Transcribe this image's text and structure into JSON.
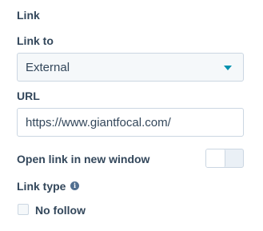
{
  "section": {
    "title": "Link"
  },
  "link_to": {
    "label": "Link to",
    "selected_value": "External",
    "caret_icon": "caret-down-icon",
    "caret_color": "#0091ae"
  },
  "url": {
    "label": "URL",
    "value": "https://www.giantfocal.com/"
  },
  "new_window": {
    "label": "Open link in new window",
    "enabled": false
  },
  "link_type": {
    "label": "Link type",
    "info_icon": "info-icon",
    "info_glyph": "i",
    "options": [
      {
        "label": "No follow",
        "checked": false
      }
    ]
  },
  "colors": {
    "text": "#33475b",
    "accent": "#0091ae",
    "border": "#cbd6e2"
  }
}
